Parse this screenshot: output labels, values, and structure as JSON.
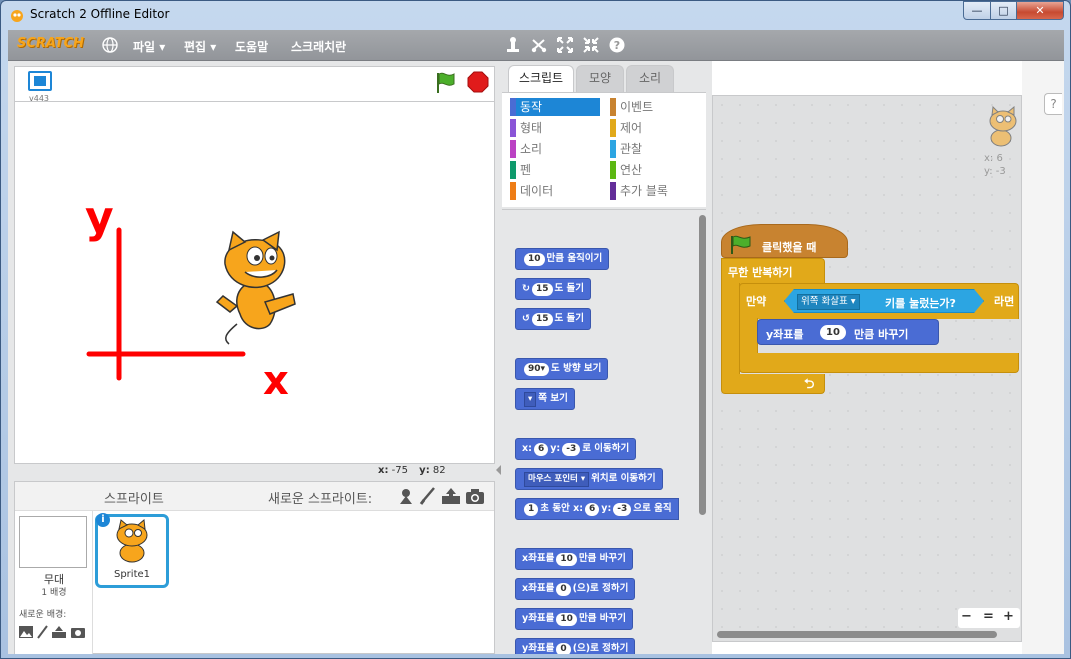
{
  "window": {
    "title": "Scratch 2 Offline Editor",
    "min": "—",
    "max": "□",
    "close": "✕"
  },
  "menubar": {
    "logo": "SCRATCH",
    "items": [
      "파일 ▾",
      "편집 ▾",
      "도움말",
      "스크래치란"
    ]
  },
  "stage": {
    "version": "v443",
    "mouse_x_label": "x:",
    "mouse_x": "-75",
    "mouse_y_label": "y:",
    "mouse_y": "82"
  },
  "drawing": {
    "y_label": "y",
    "x_label": "x",
    "color": "#ff0000"
  },
  "sprites": {
    "title": "스프라이트",
    "new_sprite_label": "새로운 스프라이트:",
    "stage_name": "무대",
    "stage_backdrops": "1 배경",
    "new_backdrop_label": "새로운 배경:",
    "sprite_name": "Sprite1",
    "info": "i"
  },
  "tabs": [
    "스크립트",
    "모양",
    "소리"
  ],
  "categories": {
    "left": [
      {
        "label": "동작",
        "color": "#4a6cd4",
        "selected": true
      },
      {
        "label": "형태",
        "color": "#8a55d7"
      },
      {
        "label": "소리",
        "color": "#bb42c3"
      },
      {
        "label": "펜",
        "color": "#0e9a6c"
      },
      {
        "label": "데이터",
        "color": "#ee7d16"
      }
    ],
    "right": [
      {
        "label": "이벤트",
        "color": "#c88330"
      },
      {
        "label": "제어",
        "color": "#e1a91a"
      },
      {
        "label": "관찰",
        "color": "#2ca5e2"
      },
      {
        "label": "연산",
        "color": "#5cb712"
      },
      {
        "label": "추가 블록",
        "color": "#632d99"
      }
    ]
  },
  "palette": {
    "move": {
      "in": "10",
      "text": "만큼 움직이기"
    },
    "turn_right": {
      "in": "15",
      "text": "도 돌기"
    },
    "turn_left": {
      "in": "15",
      "text": "도 돌기"
    },
    "point_dir": {
      "in": "90▾",
      "text": "도 방향 보기"
    },
    "point_towards": {
      "dd": "▾",
      "text": "쪽 보기"
    },
    "goto_xy": {
      "x_label": "x:",
      "x": "6",
      "y_label": "y:",
      "y": "-3",
      "text": "로 이동하기"
    },
    "goto": {
      "dd": "마우스 포인터 ▾",
      "text": "위치로 이동하기"
    },
    "glide": {
      "secs": "1",
      "text1": "초 동안 x:",
      "x": "6",
      "y_label": "y:",
      "y": "-3",
      "text2": "으로 움직"
    },
    "change_x": {
      "text1": "x좌표를",
      "in": "10",
      "text2": "만큼 바꾸기"
    },
    "set_x": {
      "text1": "x좌표를",
      "in": "0",
      "text2": "(으)로 정하기"
    },
    "change_y": {
      "text1": "y좌표를",
      "in": "10",
      "text2": "만큼 바꾸기"
    },
    "set_y": {
      "text1": "y좌표를",
      "in": "0",
      "text2": "(으)로 정하기"
    }
  },
  "scripts": {
    "sprite_x": "x: 6",
    "sprite_y": "y: -3",
    "hat": "클릭했을 때",
    "forever": "무한 반복하기",
    "if_label": "만약",
    "key_dd": "위쪽 화살표 ▾",
    "key_text": "키를 눌렀는가?",
    "then_label": "라면",
    "change_y_text1": "y좌표를",
    "change_y_in": "10",
    "change_y_text2": "만큼 바꾸기",
    "loop_arrow": "⮌"
  },
  "zoom": {
    "out": "−",
    "reset": "=",
    "in": "+"
  },
  "help": "?"
}
